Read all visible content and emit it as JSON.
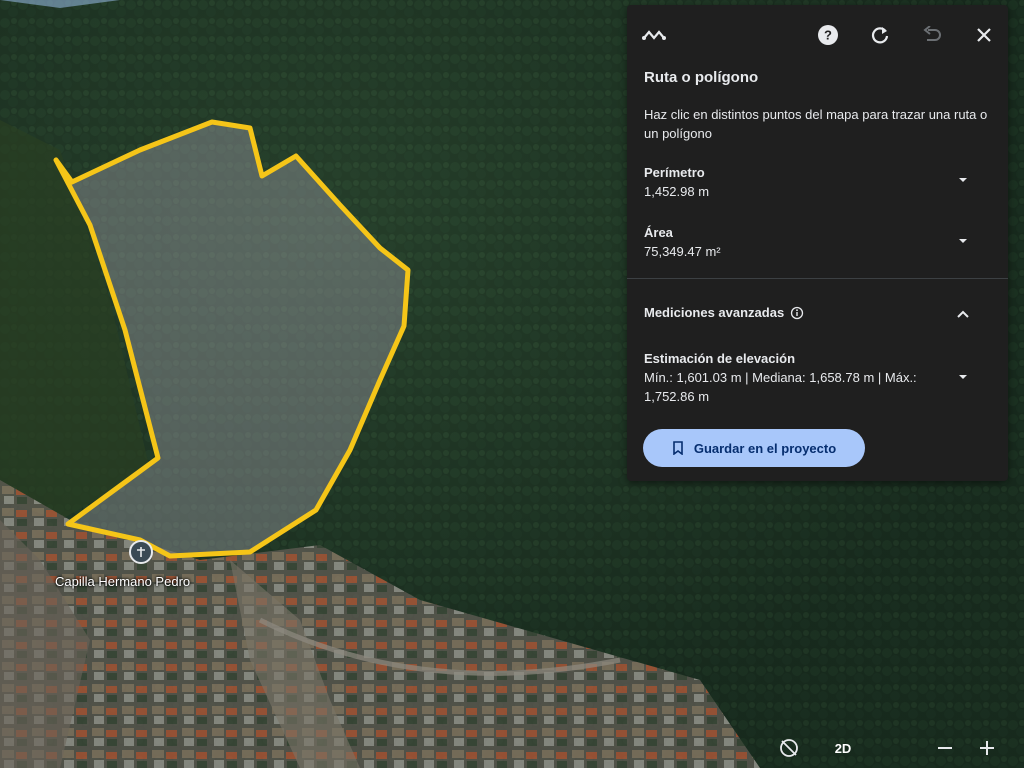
{
  "panel": {
    "title": "Ruta o polígono",
    "description": "Haz clic en distintos puntos del mapa para trazar una ruta o un polígono",
    "perimeter": {
      "label": "Perímetro",
      "value": "1,452.98 m"
    },
    "area": {
      "label": "Área",
      "value": "75,349.47 m²"
    },
    "advanced": {
      "label": "Mediciones avanzadas"
    },
    "elevation": {
      "label": "Estimación de elevación",
      "value": "Mín.: 1,601.03 m | Mediana: 1,658.78 m | Máx.: 1,752.86 m"
    },
    "save_label": "Guardar en el proyecto"
  },
  "map": {
    "place_label": "Capilla Hermano Pedro",
    "view_mode_label": "2D"
  },
  "colors": {
    "polygon_stroke": "#f5c518",
    "panel_bg": "#1f1f1f",
    "save_button_bg": "#a8c7fa"
  },
  "icons": [
    "path-icon",
    "help-icon",
    "reset-icon",
    "undo-icon",
    "close-icon",
    "chevron-down-icon",
    "chevron-up-icon",
    "info-icon",
    "bookmark-icon",
    "place-pin-icon",
    "compass-icon",
    "zoom-out-icon",
    "zoom-in-icon"
  ]
}
